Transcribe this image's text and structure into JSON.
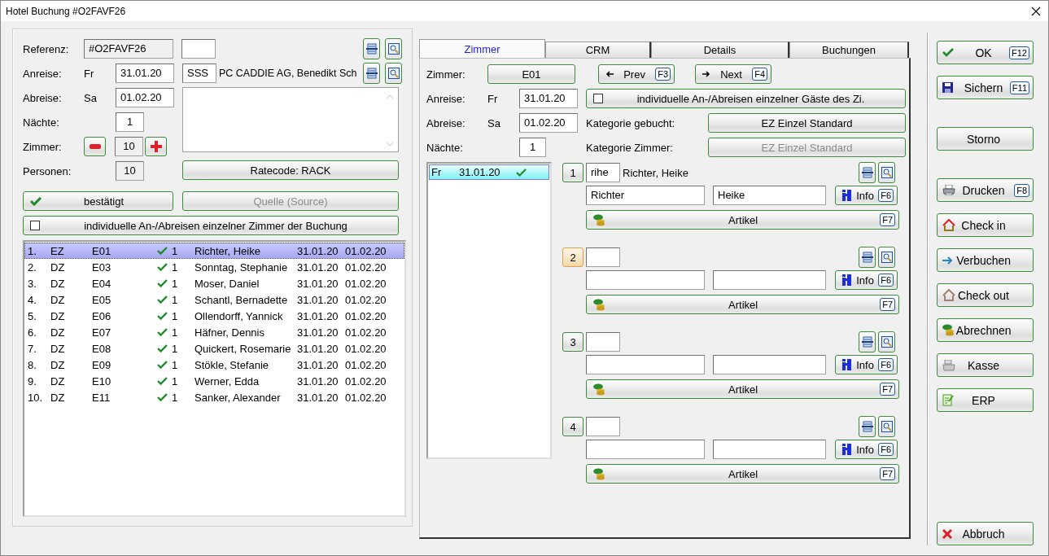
{
  "window": {
    "title": "Hotel Buchung #O2FAVF26"
  },
  "booking": {
    "referenz": {
      "label": "Referenz:",
      "value": "#O2FAVF26"
    },
    "anreise": {
      "label": "Anreise:",
      "day": "Fr",
      "value": "31.01.20",
      "code": "SSS",
      "company": "PC CADDIE AG, Benedikt Sch"
    },
    "abreise": {
      "label": "Abreise:",
      "day": "Sa",
      "value": "01.02.20"
    },
    "naechte": {
      "label": "Nächte:",
      "value": "1"
    },
    "zimmer": {
      "label": "Zimmer:",
      "value": "10"
    },
    "personen": {
      "label": "Personen:",
      "value": "10"
    },
    "ratecode": "Ratecode: RACK",
    "status": {
      "label": "bestätigt",
      "checked": true
    },
    "source": {
      "label": "Quelle (Source)",
      "disabled": true
    },
    "individual": {
      "label": "individuelle An-/Abreisen einzelner Zimmer der Buchung",
      "checked": false
    }
  },
  "rooms": [
    {
      "index": "1.",
      "type": "EZ",
      "room": "E01",
      "confirmed": true,
      "count": "1",
      "guest": "Richter, Heike",
      "arrival": "31.01.20",
      "departure": "01.02.20",
      "selected": true
    },
    {
      "index": "2.",
      "type": "DZ",
      "room": "E03",
      "confirmed": true,
      "count": "1",
      "guest": "Sonntag, Stephanie",
      "arrival": "31.01.20",
      "departure": "01.02.20",
      "selected": false
    },
    {
      "index": "3.",
      "type": "DZ",
      "room": "E04",
      "confirmed": true,
      "count": "1",
      "guest": "Moser, Daniel",
      "arrival": "31.01.20",
      "departure": "01.02.20",
      "selected": false
    },
    {
      "index": "4.",
      "type": "DZ",
      "room": "E05",
      "confirmed": true,
      "count": "1",
      "guest": "Schantl, Bernadette",
      "arrival": "31.01.20",
      "departure": "01.02.20",
      "selected": false
    },
    {
      "index": "5.",
      "type": "DZ",
      "room": "E06",
      "confirmed": true,
      "count": "1",
      "guest": "Ollendorff, Yannick",
      "arrival": "31.01.20",
      "departure": "01.02.20",
      "selected": false
    },
    {
      "index": "6.",
      "type": "DZ",
      "room": "E07",
      "confirmed": true,
      "count": "1",
      "guest": "Häfner, Dennis",
      "arrival": "31.01.20",
      "departure": "01.02.20",
      "selected": false
    },
    {
      "index": "7.",
      "type": "DZ",
      "room": "E08",
      "confirmed": true,
      "count": "1",
      "guest": "Quickert, Rosemarie",
      "arrival": "31.01.20",
      "departure": "01.02.20",
      "selected": false
    },
    {
      "index": "8.",
      "type": "DZ",
      "room": "E09",
      "confirmed": true,
      "count": "1",
      "guest": "Stökle, Stefanie",
      "arrival": "31.01.20",
      "departure": "01.02.20",
      "selected": false
    },
    {
      "index": "9.",
      "type": "DZ",
      "room": "E10",
      "confirmed": true,
      "count": "1",
      "guest": "Werner, Edda",
      "arrival": "31.01.20",
      "departure": "01.02.20",
      "selected": false
    },
    {
      "index": "10.",
      "type": "DZ",
      "room": "E11",
      "confirmed": true,
      "count": "1",
      "guest": "Sanker, Alexander",
      "arrival": "31.01.20",
      "departure": "01.02.20",
      "selected": false
    }
  ],
  "tabs": [
    {
      "label": "Zimmer",
      "selected": true
    },
    {
      "label": "CRM",
      "selected": false
    },
    {
      "label": "Details",
      "selected": false
    },
    {
      "label": "Buchungen",
      "selected": false
    }
  ],
  "room_tab": {
    "zimmer": {
      "label": "Zimmer:",
      "value": "E01"
    },
    "prev": {
      "label": "Prev",
      "key": "F3"
    },
    "next": {
      "label": "Next",
      "key": "F4"
    },
    "anreise": {
      "label": "Anreise:",
      "day": "Fr",
      "value": "31.01.20"
    },
    "abreise": {
      "label": "Abreise:",
      "day": "Sa",
      "value": "01.02.20"
    },
    "naechte": {
      "label": "Nächte:",
      "value": "1"
    },
    "individual": {
      "label": "individuelle An-/Abreisen einzelner Gäste des Zi.",
      "checked": false
    },
    "category_booked": {
      "label": "Kategorie gebucht:",
      "value": "EZ Einzel Standard",
      "disabled": false
    },
    "category_room": {
      "label": "Kategorie Zimmer:",
      "value": "EZ Einzel Standard",
      "disabled": true
    },
    "nights": [
      {
        "day": "Fr",
        "date": "31.01.20",
        "checked": true,
        "selected": true
      }
    ],
    "guests": [
      {
        "number": "1",
        "focused": false,
        "code": "rihe",
        "name": "Richter, Heike",
        "last_name": "Richter",
        "first_name": "Heike",
        "info": {
          "label": "Info",
          "key": "F6"
        },
        "articles": {
          "label": "Artikel",
          "key": "F7"
        }
      },
      {
        "number": "2",
        "focused": true,
        "info": {
          "label": "Info",
          "key": "F6"
        },
        "articles": {
          "label": "Artikel",
          "key": "F7"
        }
      },
      {
        "number": "3",
        "focused": false,
        "info": {
          "label": "Info",
          "key": "F6"
        },
        "articles": {
          "label": "Artikel",
          "key": "F7"
        }
      },
      {
        "number": "4",
        "focused": false,
        "info": {
          "label": "Info",
          "key": "F6"
        },
        "articles": {
          "label": "Artikel",
          "key": "F7"
        }
      }
    ]
  },
  "actions": [
    {
      "buttons": [
        {
          "label": "OK",
          "key": "F12",
          "kind": "check"
        },
        {
          "label": "Sichern",
          "key": "F11",
          "kind": "save"
        }
      ]
    },
    {
      "buttons": [
        {
          "label": "Storno"
        }
      ]
    },
    {
      "buttons": [
        {
          "label": "Drucken",
          "key": "F8",
          "kind": "printer"
        },
        {
          "label": "Check in",
          "kind": "checkin"
        },
        {
          "label": "Verbuchen",
          "kind": "post"
        },
        {
          "label": "Check out",
          "kind": "checkout"
        },
        {
          "label": "Abrechnen",
          "kind": "billing"
        },
        {
          "label": "Kasse",
          "kind": "register"
        },
        {
          "label": "ERP",
          "kind": "erp"
        }
      ]
    }
  ],
  "cancel": {
    "label": "Abbruch",
    "kind": "cancel"
  }
}
